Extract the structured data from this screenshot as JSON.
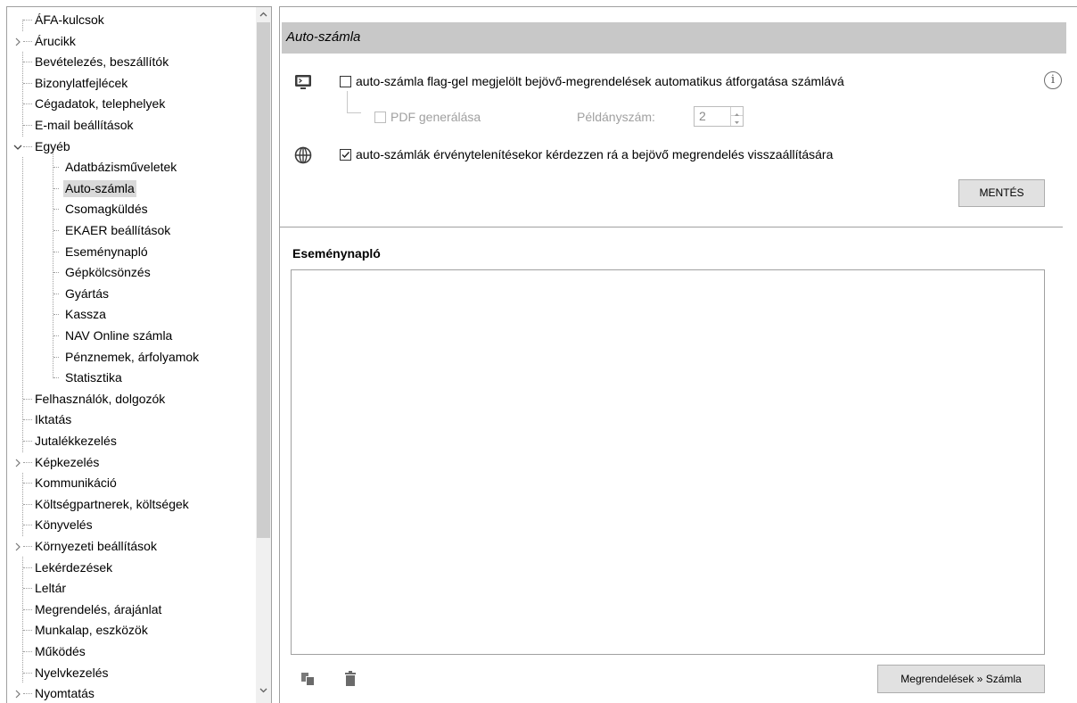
{
  "tree": {
    "items": [
      {
        "label": "ÁFA-kulcsok",
        "level": 0,
        "expander": "none"
      },
      {
        "label": "Árucikk",
        "level": 0,
        "expander": "collapsed"
      },
      {
        "label": "Bevételezés, beszállítók",
        "level": 0,
        "expander": "none"
      },
      {
        "label": "Bizonylatfejlécek",
        "level": 0,
        "expander": "none"
      },
      {
        "label": "Cégadatok, telephelyek",
        "level": 0,
        "expander": "none"
      },
      {
        "label": "E-mail beállítások",
        "level": 0,
        "expander": "none"
      },
      {
        "label": "Egyéb",
        "level": 0,
        "expander": "expanded"
      },
      {
        "label": "Adatbázisműveletek",
        "level": 1,
        "expander": "none"
      },
      {
        "label": "Auto-számla",
        "level": 1,
        "expander": "none",
        "selected": true
      },
      {
        "label": "Csomagküldés",
        "level": 1,
        "expander": "none"
      },
      {
        "label": "EKAER beállítások",
        "level": 1,
        "expander": "none"
      },
      {
        "label": "Eseménynapló",
        "level": 1,
        "expander": "none"
      },
      {
        "label": "Gépkölcsönzés",
        "level": 1,
        "expander": "none"
      },
      {
        "label": "Gyártás",
        "level": 1,
        "expander": "none"
      },
      {
        "label": "Kassza",
        "level": 1,
        "expander": "none"
      },
      {
        "label": "NAV Online számla",
        "level": 1,
        "expander": "none"
      },
      {
        "label": "Pénznemek, árfolyamok",
        "level": 1,
        "expander": "none"
      },
      {
        "label": "Statisztika",
        "level": 1,
        "expander": "none"
      },
      {
        "label": "Felhasználók, dolgozók",
        "level": 0,
        "expander": "none"
      },
      {
        "label": "Iktatás",
        "level": 0,
        "expander": "none"
      },
      {
        "label": "Jutalékkezelés",
        "level": 0,
        "expander": "none"
      },
      {
        "label": "Képkezelés",
        "level": 0,
        "expander": "collapsed"
      },
      {
        "label": "Kommunikáció",
        "level": 0,
        "expander": "none"
      },
      {
        "label": "Költségpartnerek, költségek",
        "level": 0,
        "expander": "none"
      },
      {
        "label": "Könyvelés",
        "level": 0,
        "expander": "none"
      },
      {
        "label": "Környezeti beállítások",
        "level": 0,
        "expander": "collapsed"
      },
      {
        "label": "Lekérdezések",
        "level": 0,
        "expander": "none"
      },
      {
        "label": "Leltár",
        "level": 0,
        "expander": "none"
      },
      {
        "label": "Megrendelés, árajánlat",
        "level": 0,
        "expander": "none"
      },
      {
        "label": "Munkalap, eszközök",
        "level": 0,
        "expander": "none"
      },
      {
        "label": "Működés",
        "level": 0,
        "expander": "none"
      },
      {
        "label": "Nyelvkezelés",
        "level": 0,
        "expander": "none"
      },
      {
        "label": "Nyomtatás",
        "level": 0,
        "expander": "collapsed"
      }
    ]
  },
  "section": {
    "title": "Auto-számla"
  },
  "options": {
    "auto_convert": {
      "label": "auto-számla flag-gel megjelölt bejövő-megrendelések automatikus átforgatása számlává",
      "checked": false,
      "icon": "monitor-icon"
    },
    "pdf": {
      "label": "PDF generálása",
      "checked": false,
      "enabled": false
    },
    "copies": {
      "label": "Példányszám:",
      "value": "2",
      "enabled": false
    },
    "ask_restore": {
      "label": "auto-számlák érvénytelenítésekor kérdezzen rá a bejövő megrendelés visszaállítására",
      "checked": true,
      "icon": "globe-icon"
    },
    "info_icon": "info-icon"
  },
  "buttons": {
    "save": "MENTÉS",
    "convert": "Megrendelések » Számla"
  },
  "log": {
    "title": "Eseménynapló"
  },
  "toolbar_icons": [
    "copy-icon",
    "trash-icon"
  ]
}
